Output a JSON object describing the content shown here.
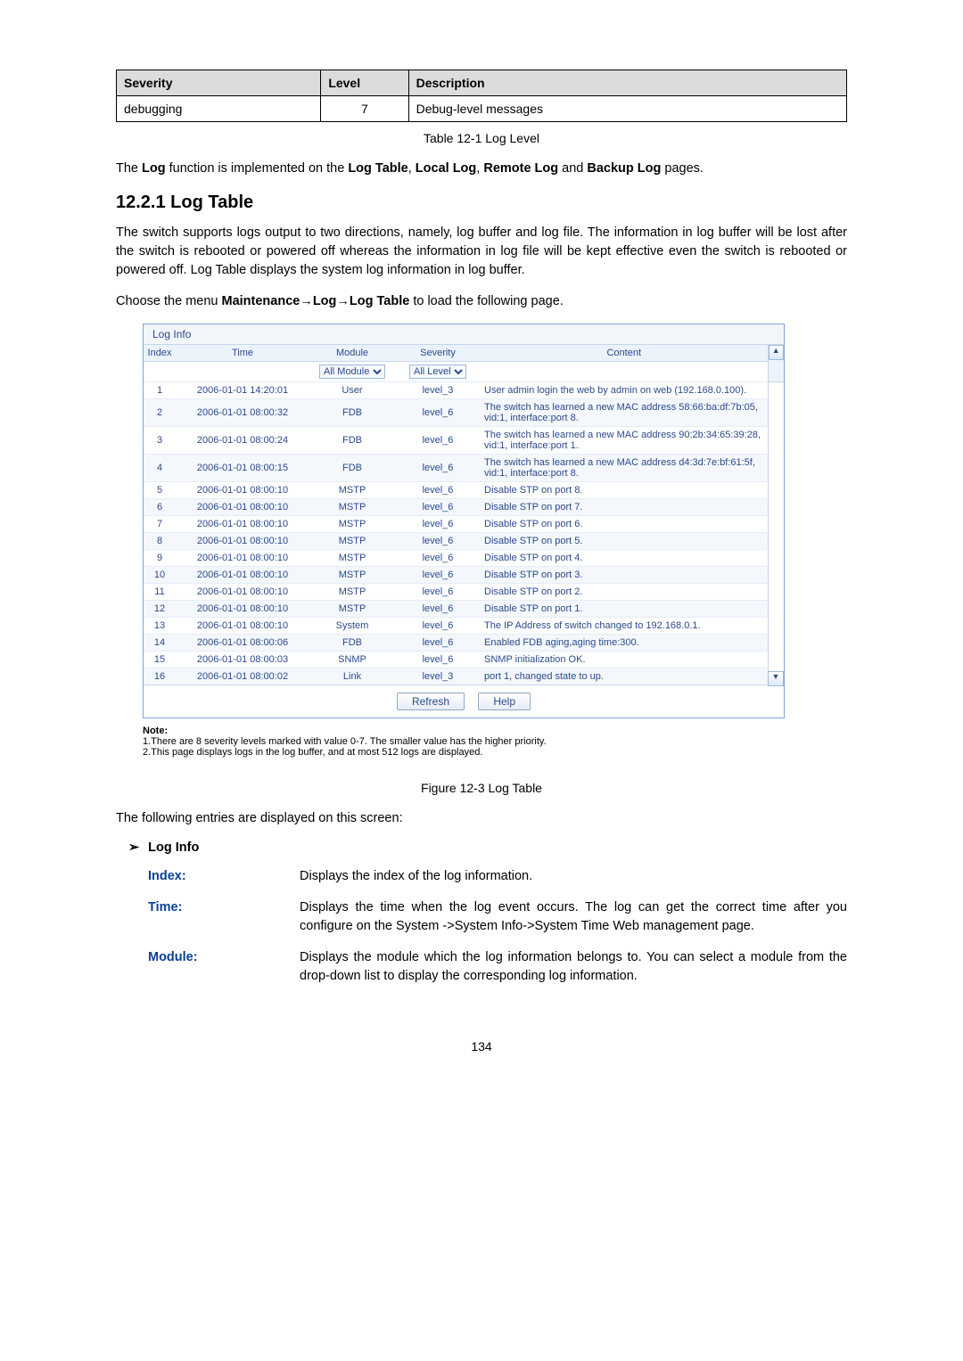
{
  "severity_table": {
    "headers": {
      "c1": "Severity",
      "c2": "Level",
      "c3": "Description"
    },
    "row": {
      "c1": "debugging",
      "c2": "7",
      "c3": "Debug-level messages"
    }
  },
  "captions": {
    "tbl": "Table 12-1 Log Level",
    "fig": "Figure 12-3 Log Table"
  },
  "paragraphs": {
    "p1a": "The ",
    "p1b": "Log",
    "p1c": " function is implemented on the ",
    "p1d": "Log Table",
    "p1e": ", ",
    "p1f": "Local Log",
    "p1g": ", ",
    "p1h": "Remote Log",
    "p1i": " and ",
    "p1j": "Backup Log",
    "p1k": " pages.",
    "h": "12.2.1 Log Table",
    "p2": "The switch supports logs output to two directions, namely, log buffer and log file. The information in log buffer will be lost after the switch is rebooted or powered off whereas the information in log file will be kept effective even the switch is rebooted or powered off. Log Table displays the system log information in log buffer.",
    "p3a": "Choose the menu ",
    "p3b": "Maintenance→Log→Log Table",
    "p3c": " to load the following page.",
    "after": "The following entries are displayed on this screen:",
    "sub": "Log Info"
  },
  "panel": {
    "title": "Log Info",
    "headers": {
      "idx": "Index",
      "time": "Time",
      "module": "Module",
      "severity": "Severity",
      "content": "Content"
    },
    "filters": {
      "module": "All Module",
      "severity": "All Level"
    },
    "rows": [
      {
        "i": "1",
        "t": "2006-01-01 14:20:01",
        "m": "User",
        "s": "level_3",
        "c": "User admin login the web by admin on web (192.168.0.100)."
      },
      {
        "i": "2",
        "t": "2006-01-01 08:00:32",
        "m": "FDB",
        "s": "level_6",
        "c": "The switch has learned a new MAC address 58:66:ba:df:7b:05, vid:1, interface:port 8."
      },
      {
        "i": "3",
        "t": "2006-01-01 08:00:24",
        "m": "FDB",
        "s": "level_6",
        "c": "The switch has learned a new MAC address 90:2b:34:65:39:28, vid:1, interface:port 1."
      },
      {
        "i": "4",
        "t": "2006-01-01 08:00:15",
        "m": "FDB",
        "s": "level_6",
        "c": "The switch has learned a new MAC address d4:3d:7e:bf:61:5f, vid:1, interface:port 8."
      },
      {
        "i": "5",
        "t": "2006-01-01 08:00:10",
        "m": "MSTP",
        "s": "level_6",
        "c": "Disable STP on port 8."
      },
      {
        "i": "6",
        "t": "2006-01-01 08:00:10",
        "m": "MSTP",
        "s": "level_6",
        "c": "Disable STP on port 7."
      },
      {
        "i": "7",
        "t": "2006-01-01 08:00:10",
        "m": "MSTP",
        "s": "level_6",
        "c": "Disable STP on port 6."
      },
      {
        "i": "8",
        "t": "2006-01-01 08:00:10",
        "m": "MSTP",
        "s": "level_6",
        "c": "Disable STP on port 5."
      },
      {
        "i": "9",
        "t": "2006-01-01 08:00:10",
        "m": "MSTP",
        "s": "level_6",
        "c": "Disable STP on port 4."
      },
      {
        "i": "10",
        "t": "2006-01-01 08:00:10",
        "m": "MSTP",
        "s": "level_6",
        "c": "Disable STP on port 3."
      },
      {
        "i": "11",
        "t": "2006-01-01 08:00:10",
        "m": "MSTP",
        "s": "level_6",
        "c": "Disable STP on port 2."
      },
      {
        "i": "12",
        "t": "2006-01-01 08:00:10",
        "m": "MSTP",
        "s": "level_6",
        "c": "Disable STP on port 1."
      },
      {
        "i": "13",
        "t": "2006-01-01 08:00:10",
        "m": "System",
        "s": "level_6",
        "c": "The IP Address of switch changed to 192.168.0.1."
      },
      {
        "i": "14",
        "t": "2006-01-01 08:00:06",
        "m": "FDB",
        "s": "level_6",
        "c": "Enabled FDB aging,aging time:300."
      },
      {
        "i": "15",
        "t": "2006-01-01 08:00:03",
        "m": "SNMP",
        "s": "level_6",
        "c": "SNMP initialization OK."
      },
      {
        "i": "16",
        "t": "2006-01-01 08:00:02",
        "m": "Link",
        "s": "level_3",
        "c": "port 1, changed state to up."
      }
    ],
    "buttons": {
      "refresh": "Refresh",
      "help": "Help"
    }
  },
  "note": {
    "title": "Note:",
    "l1": "1.There are 8 severity levels marked with value 0-7. The smaller value has the higher priority.",
    "l2": "2.This page displays logs in the log buffer, and at most 512 logs are displayed."
  },
  "defs": {
    "index": {
      "term": "Index:",
      "body": "Displays the index of the log information."
    },
    "time": {
      "term": "Time:",
      "body": "Displays the time when the log event occurs. The log can get the correct time after you configure on the System ->System Info->System Time Web management page."
    },
    "module": {
      "term": "Module:",
      "body": "Displays the module which the log information belongs to. You can select a module from the drop-down list to display the corresponding log information."
    }
  },
  "page_number": "134"
}
